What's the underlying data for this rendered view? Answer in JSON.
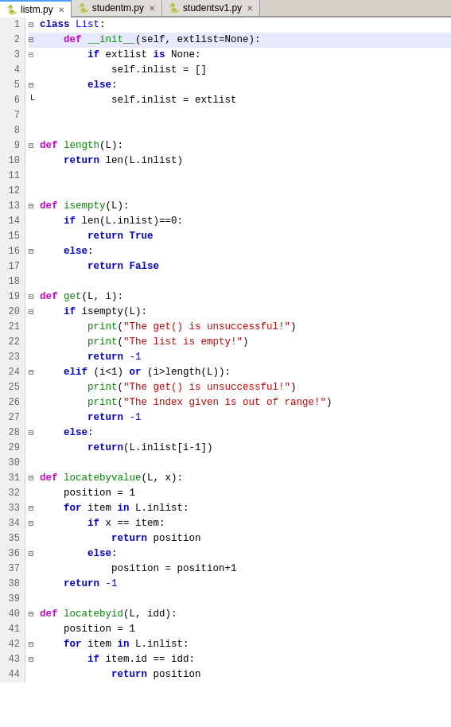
{
  "tabs": [
    {
      "id": "tab-listm",
      "label": "listm.py",
      "active": true,
      "icon": "🐍"
    },
    {
      "id": "tab-studentm",
      "label": "studentm.py",
      "active": false,
      "icon": "🐍"
    },
    {
      "id": "tab-studentsv1",
      "label": "studentsv1.py",
      "active": false,
      "icon": "🐍"
    }
  ],
  "lines": [
    {
      "num": 1,
      "indent": 0,
      "fold": "minus",
      "code": "<span class='kw-class'>class</span> <span class='fn-name'>List</span>:"
    },
    {
      "num": 2,
      "indent": 1,
      "fold": "minus",
      "highlight": true,
      "code": "    <span class='kw-def'>def</span> <span class='fn-name-green'>__init__</span>(self, extlist=None):"
    },
    {
      "num": 3,
      "indent": 2,
      "fold": "bar",
      "code": "        <span class='kw-blue'>if</span> extlist <span class='kw-blue'>is</span> None:"
    },
    {
      "num": 4,
      "indent": 3,
      "fold": "bar",
      "code": "            self.inlist = []"
    },
    {
      "num": 5,
      "indent": 2,
      "fold": "minus",
      "code": "        <span class='kw-blue'>else</span>:"
    },
    {
      "num": 6,
      "indent": 3,
      "fold": "corner",
      "code": "            self.inlist = extlist"
    },
    {
      "num": 7,
      "code": ""
    },
    {
      "num": 8,
      "code": ""
    },
    {
      "num": 9,
      "indent": 0,
      "fold": "minus",
      "code": "<span class='kw-def'>def</span> <span class='fn-name-green'>length</span>(L):"
    },
    {
      "num": 10,
      "indent": 1,
      "fold": "bar",
      "code": "    <span class='kw-blue'>return</span> len(L.inlist)"
    },
    {
      "num": 11,
      "code": ""
    },
    {
      "num": 12,
      "code": ""
    },
    {
      "num": 13,
      "indent": 0,
      "fold": "minus",
      "code": "<span class='kw-def'>def</span> <span class='fn-name-green'>isempty</span>(L):"
    },
    {
      "num": 14,
      "indent": 1,
      "fold": "bar",
      "code": "    <span class='kw-blue'>if</span> len(L.inlist)==0:"
    },
    {
      "num": 15,
      "indent": 2,
      "fold": "bar",
      "code": "        <span class='kw-blue'>return True</span>"
    },
    {
      "num": 16,
      "indent": 1,
      "fold": "minus",
      "code": "    <span class='kw-blue'>else</span>:"
    },
    {
      "num": 17,
      "indent": 2,
      "fold": "corner",
      "code": "        <span class='kw-blue'>return False</span>"
    },
    {
      "num": 18,
      "code": ""
    },
    {
      "num": 19,
      "indent": 0,
      "fold": "minus",
      "code": "<span class='kw-def'>def</span> <span class='fn-name-green'>get</span>(L, i):"
    },
    {
      "num": 20,
      "indent": 1,
      "fold": "minus",
      "code": "    <span class='kw-blue'>if</span> isempty(L):"
    },
    {
      "num": 21,
      "indent": 2,
      "fold": "bar",
      "code": "        <span class='fn-name-green'>print</span>(<span class='str-color'>\"The get() is unsuccessful!\"</span>)"
    },
    {
      "num": 22,
      "indent": 2,
      "fold": "bar",
      "code": "        <span class='fn-name-green'>print</span>(<span class='str-color'>\"The list is empty!\"</span>)"
    },
    {
      "num": 23,
      "indent": 2,
      "fold": "corner",
      "code": "        <span class='kw-blue'>return</span> <span class='num-color'>-1</span>"
    },
    {
      "num": 24,
      "indent": 1,
      "fold": "minus",
      "code": "    <span class='kw-blue'>elif</span> (i&lt;1) <span class='kw-blue'>or</span> (i&gt;length(L)):"
    },
    {
      "num": 25,
      "indent": 2,
      "fold": "bar",
      "code": "        <span class='fn-name-green'>print</span>(<span class='str-color'>\"The get() is unsuccessful!\"</span>)"
    },
    {
      "num": 26,
      "indent": 2,
      "fold": "bar",
      "code": "        <span class='fn-name-green'>print</span>(<span class='str-color'>\"The index given is out of range!\"</span>)"
    },
    {
      "num": 27,
      "indent": 2,
      "fold": "corner",
      "code": "        <span class='kw-blue'>return</span> <span class='num-color'>-1</span>"
    },
    {
      "num": 28,
      "indent": 1,
      "fold": "minus",
      "code": "    <span class='kw-blue'>else</span>:"
    },
    {
      "num": 29,
      "indent": 2,
      "fold": "corner",
      "code": "        <span class='kw-blue'>return</span>(L.inlist[i-1])"
    },
    {
      "num": 30,
      "code": ""
    },
    {
      "num": 31,
      "indent": 0,
      "fold": "minus",
      "code": "<span class='kw-def'>def</span> <span class='fn-name-green'>locatebyvalue</span>(L, x):"
    },
    {
      "num": 32,
      "indent": 1,
      "fold": "bar",
      "code": "    position = 1"
    },
    {
      "num": 33,
      "indent": 1,
      "fold": "minus",
      "code": "    <span class='kw-blue'>for</span> item <span class='kw-blue'>in</span> L.inlist:"
    },
    {
      "num": 34,
      "indent": 2,
      "fold": "minus",
      "code": "        <span class='kw-blue'>if</span> x == item:"
    },
    {
      "num": 35,
      "indent": 3,
      "fold": "bar",
      "code": "            <span class='kw-blue'>return</span> position"
    },
    {
      "num": 36,
      "indent": 2,
      "fold": "minus",
      "code": "        <span class='kw-blue'>else</span>:"
    },
    {
      "num": 37,
      "indent": 3,
      "fold": "corner",
      "code": "            position = position+1"
    },
    {
      "num": 38,
      "indent": 1,
      "fold": "corner",
      "code": "    <span class='kw-blue'>return</span> <span class='num-color'>-1</span>"
    },
    {
      "num": 39,
      "code": ""
    },
    {
      "num": 40,
      "indent": 0,
      "fold": "minus",
      "code": "<span class='kw-def'>def</span> <span class='fn-name-green'>locatebyid</span>(L, idd):"
    },
    {
      "num": 41,
      "indent": 1,
      "fold": "bar",
      "code": "    position = 1"
    },
    {
      "num": 42,
      "indent": 1,
      "fold": "minus",
      "code": "    <span class='kw-blue'>for</span> item <span class='kw-blue'>in</span> L.inlist:"
    },
    {
      "num": 43,
      "indent": 2,
      "fold": "minus",
      "code": "        <span class='kw-blue'>if</span> item.id == idd:"
    },
    {
      "num": 44,
      "indent": 3,
      "fold": "bar",
      "code": "            <span class='kw-blue'>return</span> position"
    }
  ]
}
